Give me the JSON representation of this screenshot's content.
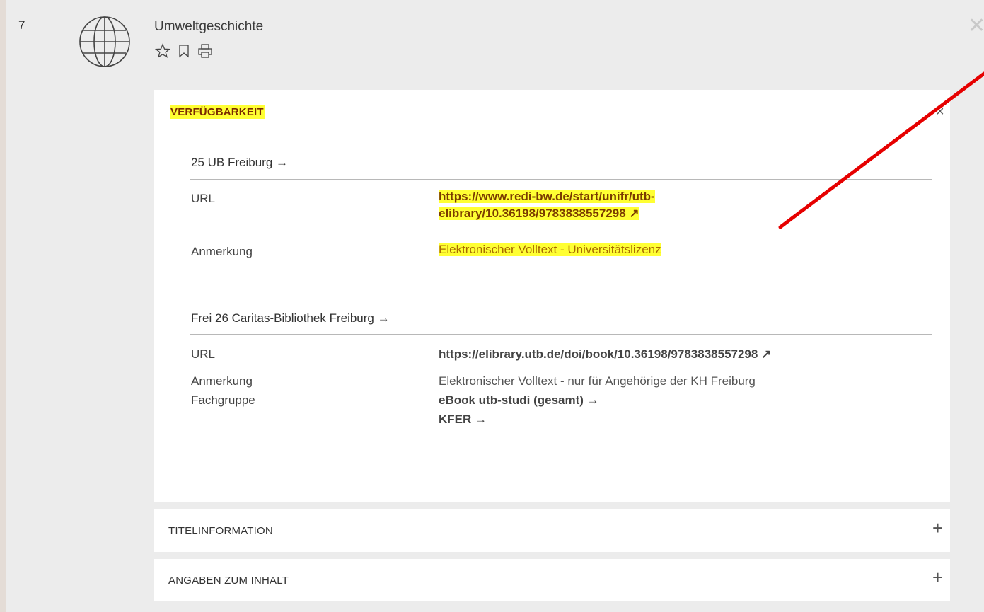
{
  "record": {
    "number": "7",
    "title": "Umweltgeschichte",
    "icons": [
      "globe-icon",
      "star-icon",
      "bookmark-icon",
      "print-icon",
      "close-icon"
    ],
    "close_glyph": "✕"
  },
  "availability": {
    "heading": "VERFÜGBARKEIT",
    "close_glyph": "×",
    "locations": [
      {
        "name": "25 UB Freiburg →",
        "url_label": "URL",
        "url_line1": "https://www.redi-bw.de/start/unifr/utb-",
        "url_line2": "elibrary/10.36198/9783838557298 ↗",
        "note_label": "Anmerkung",
        "note": "Elektronischer Volltext - Universitätslizenz"
      },
      {
        "name": "Frei 26 Caritas-Bibliothek Freiburg →",
        "url_label": "URL",
        "url": "https://elibrary.utb.de/doi/book/10.36198/9783838557298 ↗",
        "note_label": "Anmerkung",
        "note": "Elektronischer Volltext - nur für Angehörige der KH Freiburg",
        "group_label": "Fachgruppe",
        "groups": [
          "eBook utb-studi (gesamt) →",
          "KFER →"
        ]
      }
    ]
  },
  "accordions": [
    {
      "label": "TITELINFORMATION",
      "icon": "+"
    },
    {
      "label": "ANGABEN ZUM INHALT",
      "icon": "+"
    }
  ],
  "colors": {
    "highlight": "#ffff33",
    "annotation_arrow": "#e60000",
    "panel_bg": "#ececec",
    "card_bg": "#ffffff"
  }
}
